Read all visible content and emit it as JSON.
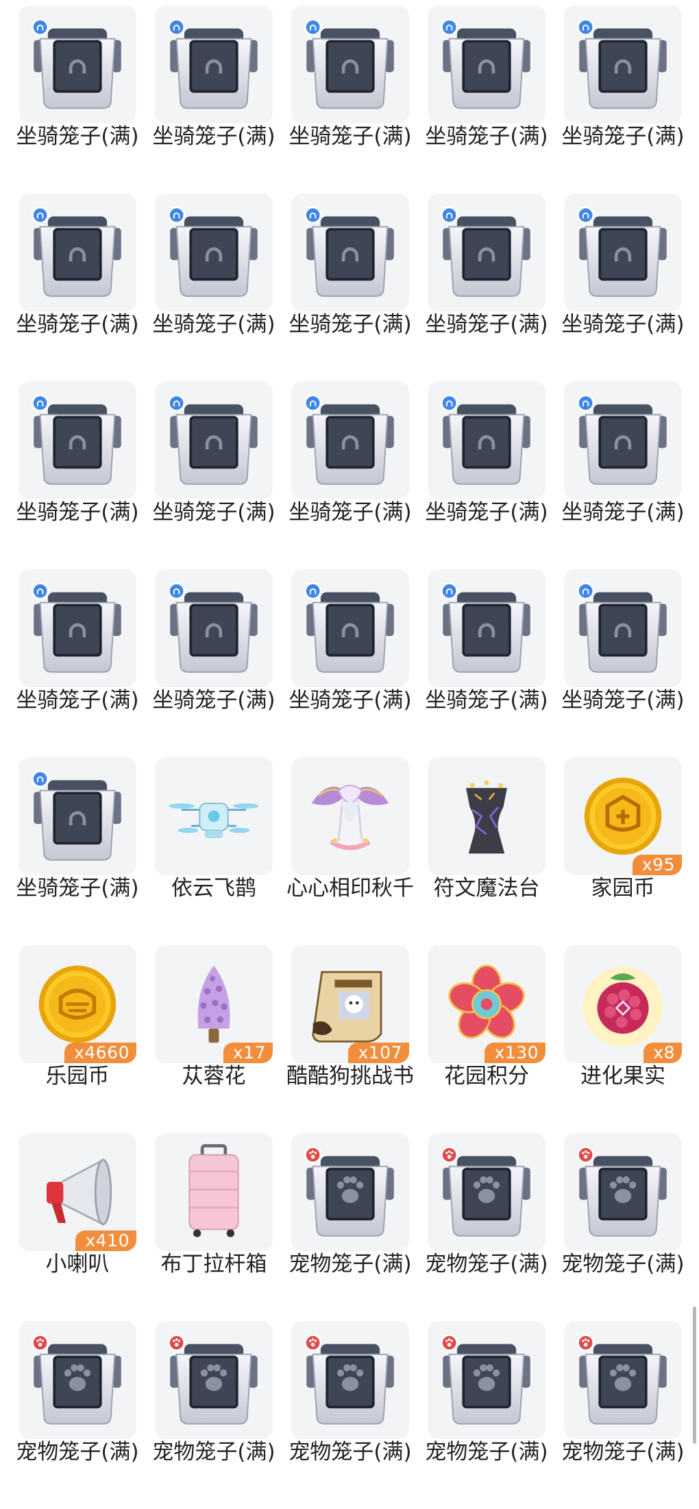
{
  "items": [
    {
      "icon": "mount-cage-icon",
      "name": "坐骑笼子(满)",
      "count": ""
    },
    {
      "icon": "mount-cage-icon",
      "name": "坐骑笼子(满)",
      "count": ""
    },
    {
      "icon": "mount-cage-icon",
      "name": "坐骑笼子(满)",
      "count": ""
    },
    {
      "icon": "mount-cage-icon",
      "name": "坐骑笼子(满)",
      "count": ""
    },
    {
      "icon": "mount-cage-icon",
      "name": "坐骑笼子(满)",
      "count": ""
    },
    {
      "icon": "mount-cage-icon",
      "name": "坐骑笼子(满)",
      "count": ""
    },
    {
      "icon": "mount-cage-icon",
      "name": "坐骑笼子(满)",
      "count": ""
    },
    {
      "icon": "mount-cage-icon",
      "name": "坐骑笼子(满)",
      "count": ""
    },
    {
      "icon": "mount-cage-icon",
      "name": "坐骑笼子(满)",
      "count": ""
    },
    {
      "icon": "mount-cage-icon",
      "name": "坐骑笼子(满)",
      "count": ""
    },
    {
      "icon": "mount-cage-icon",
      "name": "坐骑笼子(满)",
      "count": ""
    },
    {
      "icon": "mount-cage-icon",
      "name": "坐骑笼子(满)",
      "count": ""
    },
    {
      "icon": "mount-cage-icon",
      "name": "坐骑笼子(满)",
      "count": ""
    },
    {
      "icon": "mount-cage-icon",
      "name": "坐骑笼子(满)",
      "count": ""
    },
    {
      "icon": "mount-cage-icon",
      "name": "坐骑笼子(满)",
      "count": ""
    },
    {
      "icon": "mount-cage-icon",
      "name": "坐骑笼子(满)",
      "count": ""
    },
    {
      "icon": "mount-cage-icon",
      "name": "坐骑笼子(满)",
      "count": ""
    },
    {
      "icon": "mount-cage-icon",
      "name": "坐骑笼子(满)",
      "count": ""
    },
    {
      "icon": "mount-cage-icon",
      "name": "坐骑笼子(满)",
      "count": ""
    },
    {
      "icon": "mount-cage-icon",
      "name": "坐骑笼子(满)",
      "count": ""
    },
    {
      "icon": "mount-cage-icon",
      "name": "坐骑笼子(满)",
      "count": ""
    },
    {
      "icon": "drone-icon",
      "name": "依云飞鹊",
      "count": ""
    },
    {
      "icon": "swing-icon",
      "name": "心心相印秋千",
      "count": ""
    },
    {
      "icon": "rune-altar-icon",
      "name": "符文魔法台",
      "count": ""
    },
    {
      "icon": "home-coin-icon",
      "name": "家园币",
      "count": "x95"
    },
    {
      "icon": "park-coin-icon",
      "name": "乐园币",
      "count": "x4660"
    },
    {
      "icon": "cistanche-flower-icon",
      "name": "苁蓉花",
      "count": "x17"
    },
    {
      "icon": "wanted-scroll-icon",
      "name": "酷酷狗挑战书",
      "count": "x107"
    },
    {
      "icon": "flower-token-icon",
      "name": "花园积分",
      "count": "x130"
    },
    {
      "icon": "evolution-fruit-icon",
      "name": "进化果实",
      "count": "x8"
    },
    {
      "icon": "megaphone-icon",
      "name": "小喇叭",
      "count": "x410"
    },
    {
      "icon": "suitcase-icon",
      "name": "布丁拉杆箱",
      "count": ""
    },
    {
      "icon": "pet-cage-icon",
      "name": "宠物笼子(满)",
      "count": ""
    },
    {
      "icon": "pet-cage-icon",
      "name": "宠物笼子(满)",
      "count": ""
    },
    {
      "icon": "pet-cage-icon",
      "name": "宠物笼子(满)",
      "count": ""
    },
    {
      "icon": "pet-cage-icon",
      "name": "宠物笼子(满)",
      "count": ""
    },
    {
      "icon": "pet-cage-icon",
      "name": "宠物笼子(满)",
      "count": ""
    },
    {
      "icon": "pet-cage-icon",
      "name": "宠物笼子(满)",
      "count": ""
    },
    {
      "icon": "pet-cage-icon",
      "name": "宠物笼子(满)",
      "count": ""
    },
    {
      "icon": "pet-cage-icon",
      "name": "宠物笼子(满)",
      "count": ""
    }
  ],
  "colors": {
    "badge": "#f28d3c",
    "mount_tag": "#3f86e8",
    "pet_tag": "#e04a4a"
  }
}
